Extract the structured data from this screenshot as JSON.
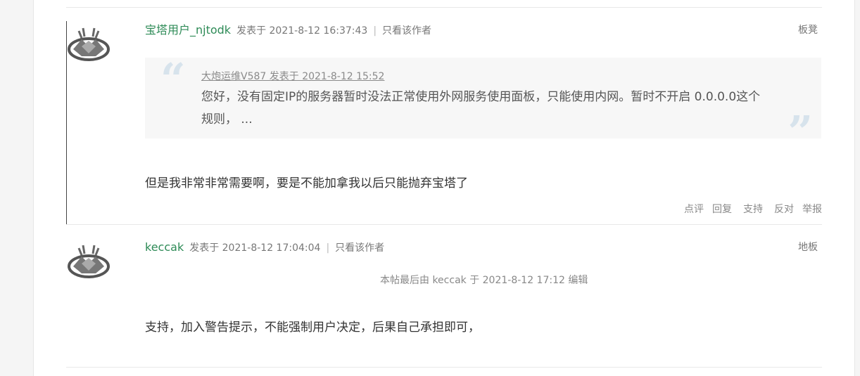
{
  "posts": [
    {
      "author": "宝塔用户_njtodk",
      "posted_at": "发表于 2021-8-12 16:37:43",
      "separator": "|",
      "only_author": "只看该作者",
      "floor": "板凳",
      "quote": {
        "header": "大炮运维V587 发表于 2021-8-12 15:52",
        "text": "您好，没有固定IP的服务器暂时没法正常使用外网服务使用面板，只能使用内网。暂时不开启 0.0.0.0这个规则， ..."
      },
      "content": "但是我非常非常需要啊，要是不能加拿我以后只能抛弃宝塔了",
      "actions": [
        "点评",
        "回复",
        "支持",
        "反对",
        "举报"
      ]
    },
    {
      "author": "keccak",
      "posted_at": "发表于 2021-8-12 17:04:04",
      "separator": "|",
      "only_author": "只看该作者",
      "floor": "地板",
      "edit_note": "本帖最后由 keccak 于 2021-8-12 17:12 编辑",
      "content": "支持，加入警告提示，不能强制用户决定，后果自己承担即可，"
    }
  ],
  "icons": {
    "avatar": "default-avatar-icon"
  }
}
